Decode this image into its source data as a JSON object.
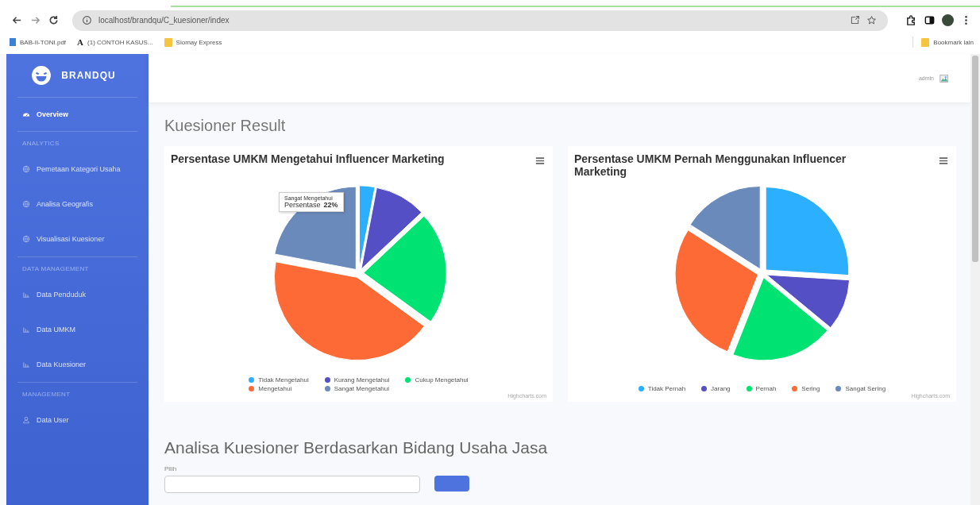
{
  "browser": {
    "url": "localhost/brandqu/C_kuesioner/index",
    "bookmarks": [
      {
        "label": "BAB-II-TONI.pdf",
        "kind": "pdf"
      },
      {
        "label": "(1) CONTOH KASUS...",
        "kind": "letter",
        "glyph": "A"
      },
      {
        "label": "Siomay Express",
        "kind": "folder"
      }
    ],
    "other_bookmarks": "Bookmark lain"
  },
  "sidebar": {
    "brand": "BRANDQU",
    "sections": [
      {
        "items": [
          {
            "label": "Overview",
            "selected": true
          }
        ]
      },
      {
        "heading": "ANALYTICS",
        "items": [
          {
            "label": "Pemetaan Kategori Usaha",
            "selected": false
          },
          {
            "label": "Analisa Geografis",
            "selected": false
          },
          {
            "label": "Visualisasi Kuesioner",
            "selected": false
          }
        ]
      },
      {
        "heading": "DATA MANAGEMENT",
        "items": [
          {
            "label": "Data Penduduk",
            "selected": false
          },
          {
            "label": "Data UMKM",
            "selected": false
          },
          {
            "label": "Data Kuesioner",
            "selected": false
          }
        ]
      },
      {
        "heading": "MANAGEMENT",
        "items": [
          {
            "label": "Data User",
            "selected": false
          }
        ]
      }
    ]
  },
  "topbar": {
    "user": "admin"
  },
  "page_title": "Kuesioner Result",
  "charts": [
    {
      "title": "Persentase UMKM Mengetahui Influencer Marketing",
      "legend": [
        {
          "label": "Tidak Mengetahui",
          "color": "#2caffe"
        },
        {
          "label": "Kurang Mengetahui",
          "color": "#544fc5"
        },
        {
          "label": "Cukup Mengetahui",
          "color": "#00e272"
        },
        {
          "label": "Mengetahui",
          "color": "#fe6a35"
        },
        {
          "label": "Sangat Mengetahui",
          "color": "#6b8abc"
        }
      ],
      "tooltip": {
        "title": "Sangat Mengetahui",
        "label": "Persentase",
        "value": "22%"
      },
      "credits": "Highcharts.com"
    },
    {
      "title": "Persentase UMKM Pernah Menggunakan Influencer Marketing",
      "legend": [
        {
          "label": "Tidak Pernah",
          "color": "#2caffe"
        },
        {
          "label": "Jarang",
          "color": "#544fc5"
        },
        {
          "label": "Pernah",
          "color": "#00e272"
        },
        {
          "label": "Sering",
          "color": "#fe6a35"
        },
        {
          "label": "Sangat Sering",
          "color": "#6b8abc"
        }
      ],
      "credits": "Highcharts.com"
    }
  ],
  "section_title": "Analisa Kuesioner Berdasarkan Bidang Usaha Jasa",
  "filter": {
    "label": "Pilih"
  }
}
